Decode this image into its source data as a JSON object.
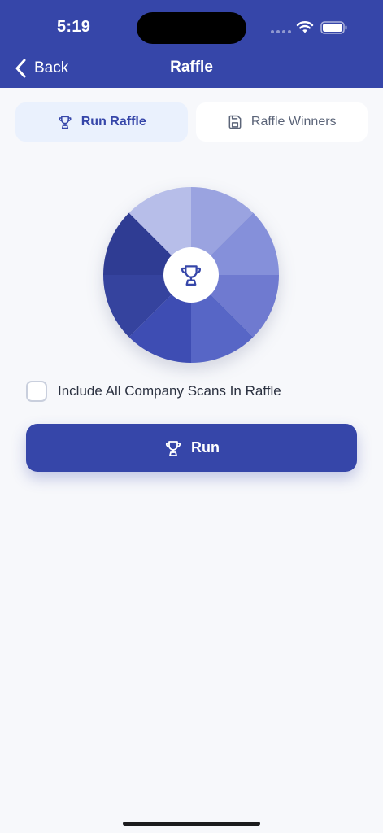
{
  "status_bar": {
    "time": "5:19"
  },
  "nav": {
    "back_label": "Back",
    "title": "Raffle"
  },
  "tabs": [
    {
      "label": "Run Raffle",
      "icon": "trophy-icon",
      "active": true
    },
    {
      "label": "Raffle Winners",
      "icon": "save-icon",
      "active": false
    }
  ],
  "wheel": {
    "center_icon": "trophy-icon",
    "segment_colors": [
      "#9aa3e0",
      "#8590da",
      "#6f7ad0",
      "#5766c6",
      "#3e4db3",
      "#35439e",
      "#2f3c93",
      "#b7bee9"
    ]
  },
  "options": {
    "include_all_label": "Include All Company Scans In Raffle",
    "include_all_checked": false
  },
  "actions": {
    "run_label": "Run"
  },
  "colors": {
    "primary": "#3646a9",
    "background": "#f7f8fb",
    "tab_active_bg": "#eaf1fd"
  }
}
